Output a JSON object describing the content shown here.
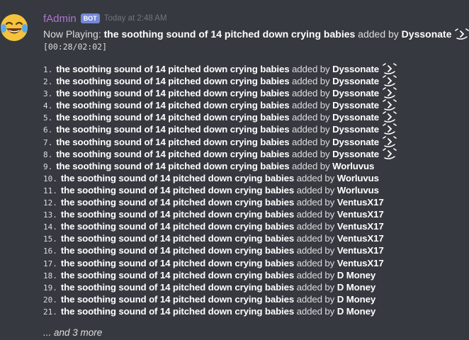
{
  "message": {
    "author": "fAdmin",
    "bot_tag": "BOT",
    "timestamp": "Today at 2:48 AM",
    "avatar_icon": "laughing-crying-emoji-icon"
  },
  "now_playing": {
    "label": "Now Playing:",
    "title": "the soothing sound of 14 pitched down crying babies",
    "added_by_label": "added by",
    "user": "Dyssonate",
    "user_emote": "smirk-face-emote-icon",
    "progress": "[00:28/02:02]"
  },
  "queue": [
    {
      "num": "1.",
      "title": "the soothing sound of 14 pitched down crying babies",
      "by": "added by",
      "user": "Dyssonate",
      "emote": true
    },
    {
      "num": "2.",
      "title": "the soothing sound of 14 pitched down crying babies",
      "by": "added by",
      "user": "Dyssonate",
      "emote": true
    },
    {
      "num": "3.",
      "title": "the soothing sound of 14 pitched down crying babies",
      "by": "added by",
      "user": "Dyssonate",
      "emote": true
    },
    {
      "num": "4.",
      "title": "the soothing sound of 14 pitched down crying babies",
      "by": "added by",
      "user": "Dyssonate",
      "emote": true
    },
    {
      "num": "5.",
      "title": "the soothing sound of 14 pitched down crying babies",
      "by": "added by",
      "user": "Dyssonate",
      "emote": true
    },
    {
      "num": "6.",
      "title": "the soothing sound of 14 pitched down crying babies",
      "by": "added by",
      "user": "Dyssonate",
      "emote": true
    },
    {
      "num": "7.",
      "title": "the soothing sound of 14 pitched down crying babies",
      "by": "added by",
      "user": "Dyssonate",
      "emote": true
    },
    {
      "num": "8.",
      "title": "the soothing sound of 14 pitched down crying babies",
      "by": "added by",
      "user": "Dyssonate",
      "emote": true
    },
    {
      "num": "9.",
      "title": "the soothing sound of 14 pitched down crying babies",
      "by": "added by",
      "user": "Worluvus",
      "emote": false
    },
    {
      "num": "10.",
      "title": "the soothing sound of 14 pitched down crying babies",
      "by": "added by",
      "user": "Worluvus",
      "emote": false
    },
    {
      "num": "11.",
      "title": "the soothing sound of 14 pitched down crying babies",
      "by": "added by",
      "user": "Worluvus",
      "emote": false
    },
    {
      "num": "12.",
      "title": "the soothing sound of 14 pitched down crying babies",
      "by": "added by",
      "user": "VentusX17",
      "emote": false
    },
    {
      "num": "13.",
      "title": "the soothing sound of 14 pitched down crying babies",
      "by": "added by",
      "user": "VentusX17",
      "emote": false
    },
    {
      "num": "14.",
      "title": "the soothing sound of 14 pitched down crying babies",
      "by": "added by",
      "user": "VentusX17",
      "emote": false
    },
    {
      "num": "15.",
      "title": "the soothing sound of 14 pitched down crying babies",
      "by": "added by",
      "user": "VentusX17",
      "emote": false
    },
    {
      "num": "16.",
      "title": "the soothing sound of 14 pitched down crying babies",
      "by": "added by",
      "user": "VentusX17",
      "emote": false
    },
    {
      "num": "17.",
      "title": "the soothing sound of 14 pitched down crying babies",
      "by": "added by",
      "user": "VentusX17",
      "emote": false
    },
    {
      "num": "18.",
      "title": "the soothing sound of 14 pitched down crying babies",
      "by": "added by",
      "user": "D Money",
      "emote": false
    },
    {
      "num": "19.",
      "title": "the soothing sound of 14 pitched down crying babies",
      "by": "added by",
      "user": "D Money",
      "emote": false
    },
    {
      "num": "20.",
      "title": "the soothing sound of 14 pitched down crying babies",
      "by": "added by",
      "user": "D Money",
      "emote": false
    },
    {
      "num": "21.",
      "title": "the soothing sound of 14 pitched down crying babies",
      "by": "added by",
      "user": "D Money",
      "emote": false
    }
  ],
  "more_text": "... and 3 more",
  "colors": {
    "background": "#36393f",
    "username": "#b074d4",
    "bot_tag": "#7289da",
    "text": "#dcddde",
    "bold": "#ffffff",
    "timestamp": "#72767d"
  }
}
